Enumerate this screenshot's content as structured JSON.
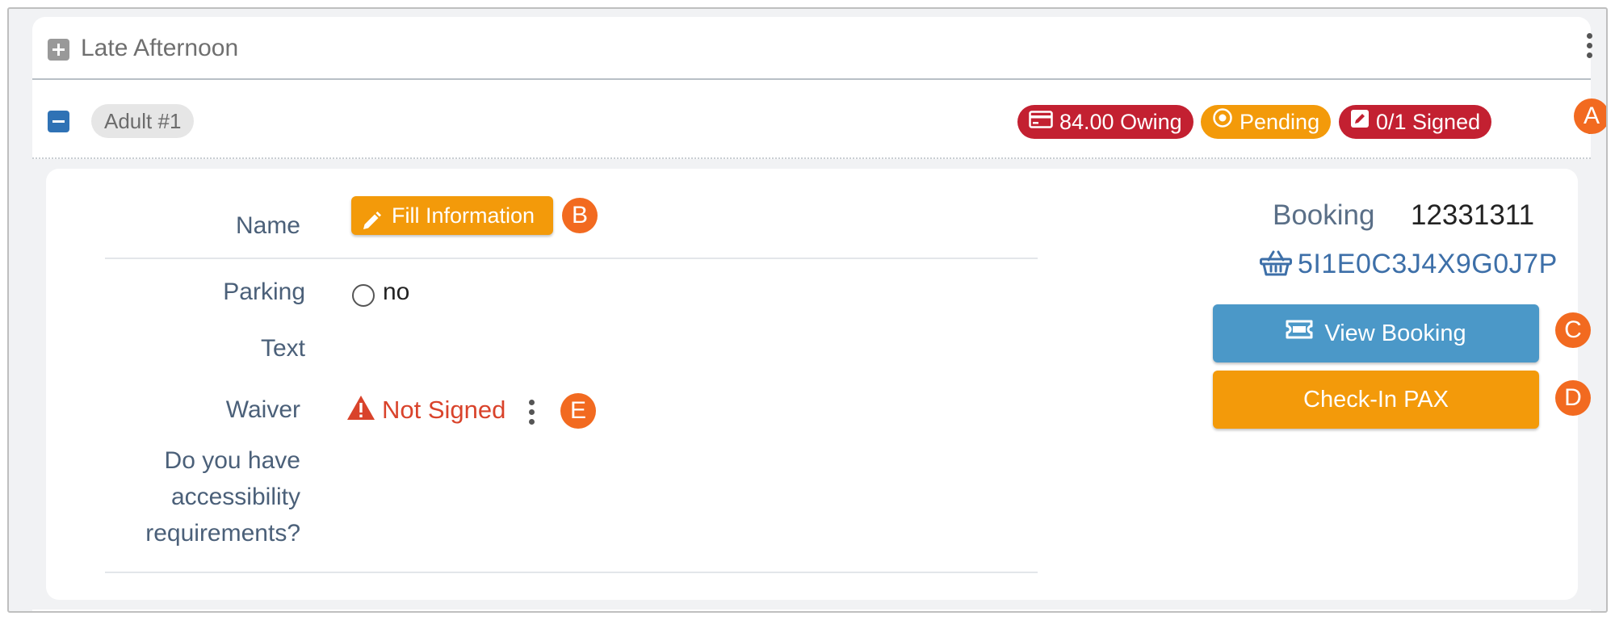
{
  "section": {
    "title": "Late Afternoon"
  },
  "participant": {
    "pill": "Adult #1",
    "badges": {
      "owing": "84.00 Owing",
      "pending": "Pending",
      "signed": "0/1 Signed"
    }
  },
  "details": {
    "name_label": "Name",
    "fill_button": "Fill Information",
    "parking_label": "Parking",
    "parking_value": "no",
    "text_label": "Text",
    "waiver_label": "Waiver",
    "waiver_status": "Not Signed",
    "accessibility_label_line1": "Do you have",
    "accessibility_label_line2": "accessibility",
    "accessibility_label_line3": "requirements?"
  },
  "booking": {
    "label": "Booking",
    "number": "12331311",
    "code": "5I1E0C3J4X9G0J7P",
    "view_button": "View Booking",
    "checkin_button": "Check-In PAX"
  },
  "markers": {
    "a": "A",
    "b": "B",
    "c": "C",
    "d": "D",
    "e": "E"
  },
  "colors": {
    "red_badge": "#c32031",
    "orange": "#f39a0a",
    "blue_button": "#4b98c8",
    "marker": "#f26a20",
    "warning_text": "#d9432b"
  },
  "icons": {
    "expand": "plus-square-icon",
    "collapse": "minus-square-icon",
    "menu": "vertical-ellipsis-icon",
    "payment": "credit-card-icon",
    "pending": "dot-circle-icon",
    "signed": "edit-square-icon",
    "fill": "pencil-icon",
    "warning": "warning-triangle-icon",
    "basket": "basket-icon",
    "ticket": "ticket-icon"
  }
}
